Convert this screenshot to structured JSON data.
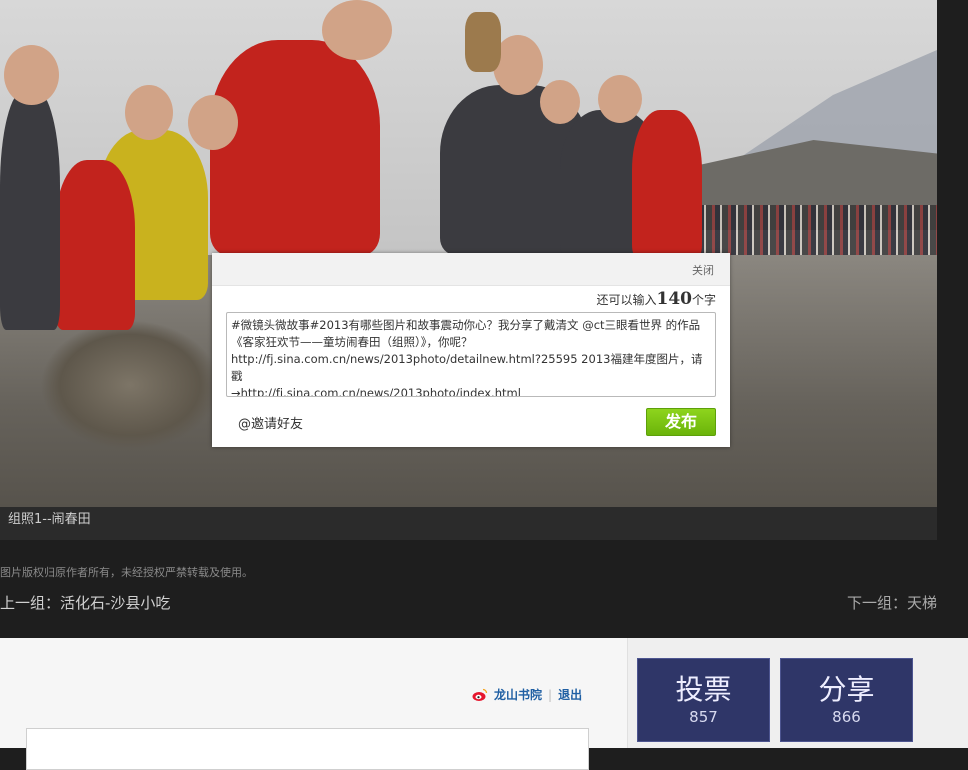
{
  "photo": {
    "caption": "组照1--闹春田"
  },
  "share_dialog": {
    "close_label": "关闭",
    "counter_prefix": "还可以输入",
    "counter_value": "140",
    "counter_suffix": "个字",
    "text_line1": "#微镜头微故事#2013有哪些图片和故事震动你心？我分享了戴清文 @ct三眼看世界 的作品",
    "text_line2": "《客家狂欢节——童坊闹春田（组照）》，你呢？",
    "text_line3": "http://fj.sina.com.cn/news/2013photo/detailnew.html?25595 2013福建年度图片，请戳",
    "text_line4": "→http://fj.sina.com.cn/news/2013photo/index.html",
    "invite_label": "@邀请好友",
    "publish_label": "发布"
  },
  "footer": {
    "copyright": "图片版权归原作者所有，未经授权严禁转载及使用。",
    "prev_label": "上一组：活化石-沙县小吃",
    "next_label": "下一组：天梯"
  },
  "bottom": {
    "user_name": "龙山书院",
    "logout_label": "退出",
    "vote_label": "投票",
    "vote_count": "857",
    "share_label": "分享",
    "share_count": "866"
  },
  "colors": {
    "publish_green": "#7ac314",
    "button_navy": "#2f3668",
    "link_blue": "#1f5fa3"
  }
}
